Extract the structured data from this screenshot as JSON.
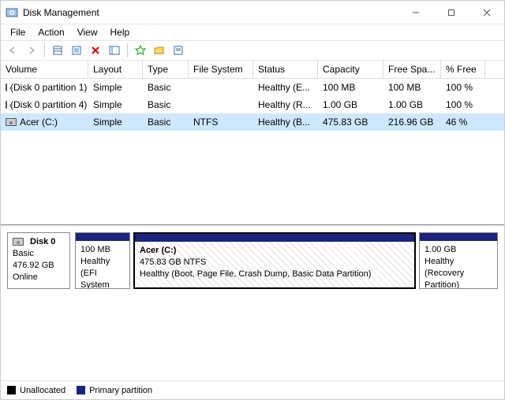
{
  "title": "Disk Management",
  "menu": {
    "file": "File",
    "action": "Action",
    "view": "View",
    "help": "Help"
  },
  "columns": {
    "volume": "Volume",
    "layout": "Layout",
    "type": "Type",
    "fs": "File System",
    "status": "Status",
    "capacity": "Capacity",
    "free": "Free Spa...",
    "pct": "% Free"
  },
  "rows": [
    {
      "volume": "(Disk 0 partition 1)",
      "layout": "Simple",
      "type": "Basic",
      "fs": "",
      "status": "Healthy (E...",
      "capacity": "100 MB",
      "free": "100 MB",
      "pct": "100 %"
    },
    {
      "volume": "(Disk 0 partition 4)",
      "layout": "Simple",
      "type": "Basic",
      "fs": "",
      "status": "Healthy (R...",
      "capacity": "1.00 GB",
      "free": "1.00 GB",
      "pct": "100 %"
    },
    {
      "volume": "Acer (C:)",
      "layout": "Simple",
      "type": "Basic",
      "fs": "NTFS",
      "status": "Healthy (B...",
      "capacity": "475.83 GB",
      "free": "216.96 GB",
      "pct": "46 %"
    }
  ],
  "disk": {
    "name": "Disk 0",
    "type": "Basic",
    "size": "476.92 GB",
    "state": "Online"
  },
  "parts": [
    {
      "name": "",
      "size": "100 MB",
      "status": "Healthy (EFI System"
    },
    {
      "name": "Acer  (C:)",
      "size": "475.83 GB NTFS",
      "status": "Healthy (Boot, Page File, Crash Dump, Basic Data Partition)"
    },
    {
      "name": "",
      "size": "1.00 GB",
      "status": "Healthy (Recovery Partition)"
    }
  ],
  "legend": {
    "unallocated": "Unallocated",
    "primary": "Primary partition"
  },
  "selected_row": 2,
  "selected_part": 1
}
